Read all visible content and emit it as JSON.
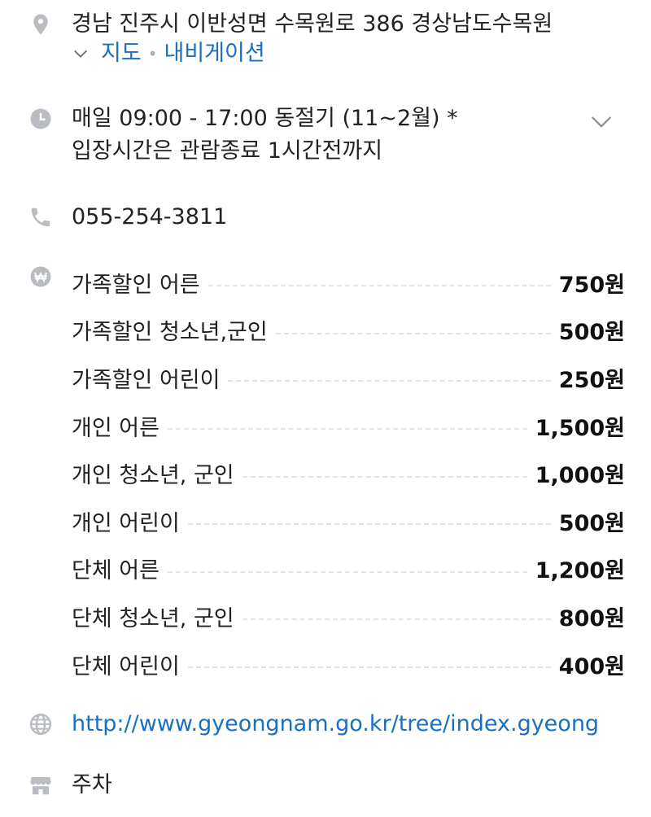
{
  "address": {
    "text": "경남 진주시 이반성면 수목원로 386 경상남도수목원",
    "map_link": "지도",
    "separator": "•",
    "navigation_link": "내비게이션"
  },
  "hours": {
    "line1": "매일 09:00 - 17:00 동절기 (11~2월) *",
    "line2": "입장시간은 관람종료 1시간전까지"
  },
  "phone": "055-254-3811",
  "prices": [
    {
      "label": "가족할인 어른",
      "value": "750원"
    },
    {
      "label": "가족할인 청소년,군인",
      "value": "500원"
    },
    {
      "label": "가족할인 어린이",
      "value": "250원"
    },
    {
      "label": "개인 어른",
      "value": "1,500원"
    },
    {
      "label": "개인 청소년, 군인",
      "value": "1,000원"
    },
    {
      "label": "개인 어린이",
      "value": "500원"
    },
    {
      "label": "단체 어른",
      "value": "1,200원"
    },
    {
      "label": "단체 청소년, 군인",
      "value": "800원"
    },
    {
      "label": "단체 어린이",
      "value": "400원"
    }
  ],
  "website": "http://www.gyeongnam.go.kr/tree/index.gyeong",
  "facilities": "주차",
  "colors": {
    "link": "#1a6fbf",
    "icon": "#b9bcc0",
    "text": "#222222"
  },
  "icons": [
    "location-pin-icon",
    "chevron-down-icon",
    "clock-icon",
    "phone-icon",
    "won-icon",
    "globe-icon",
    "store-icon"
  ]
}
